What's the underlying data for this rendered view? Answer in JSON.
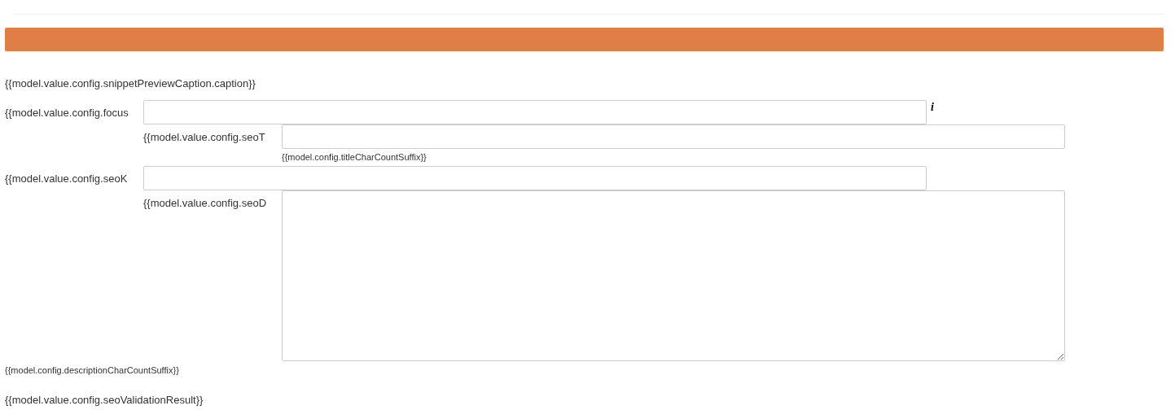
{
  "caption": "{{model.value.config.snippetPreviewCaption.caption}}",
  "fields": [
    {
      "kind": "input",
      "indent": false,
      "label": "{{model.value.config.focus",
      "info": "i"
    },
    {
      "kind": "input",
      "indent": true,
      "label": "{{model.value.config.seoT",
      "suffix": "{{model.config.titleCharCountSuffix}}"
    },
    {
      "kind": "input",
      "indent": false,
      "label": "{{model.value.config.seoK"
    },
    {
      "kind": "textarea",
      "indent": true,
      "label": "{{model.value.config.seoD"
    }
  ],
  "description_suffix": "{{model.config.descriptionCharCountSuffix}}",
  "validation_result": "{{model.value.config.seoValidationResult}}"
}
